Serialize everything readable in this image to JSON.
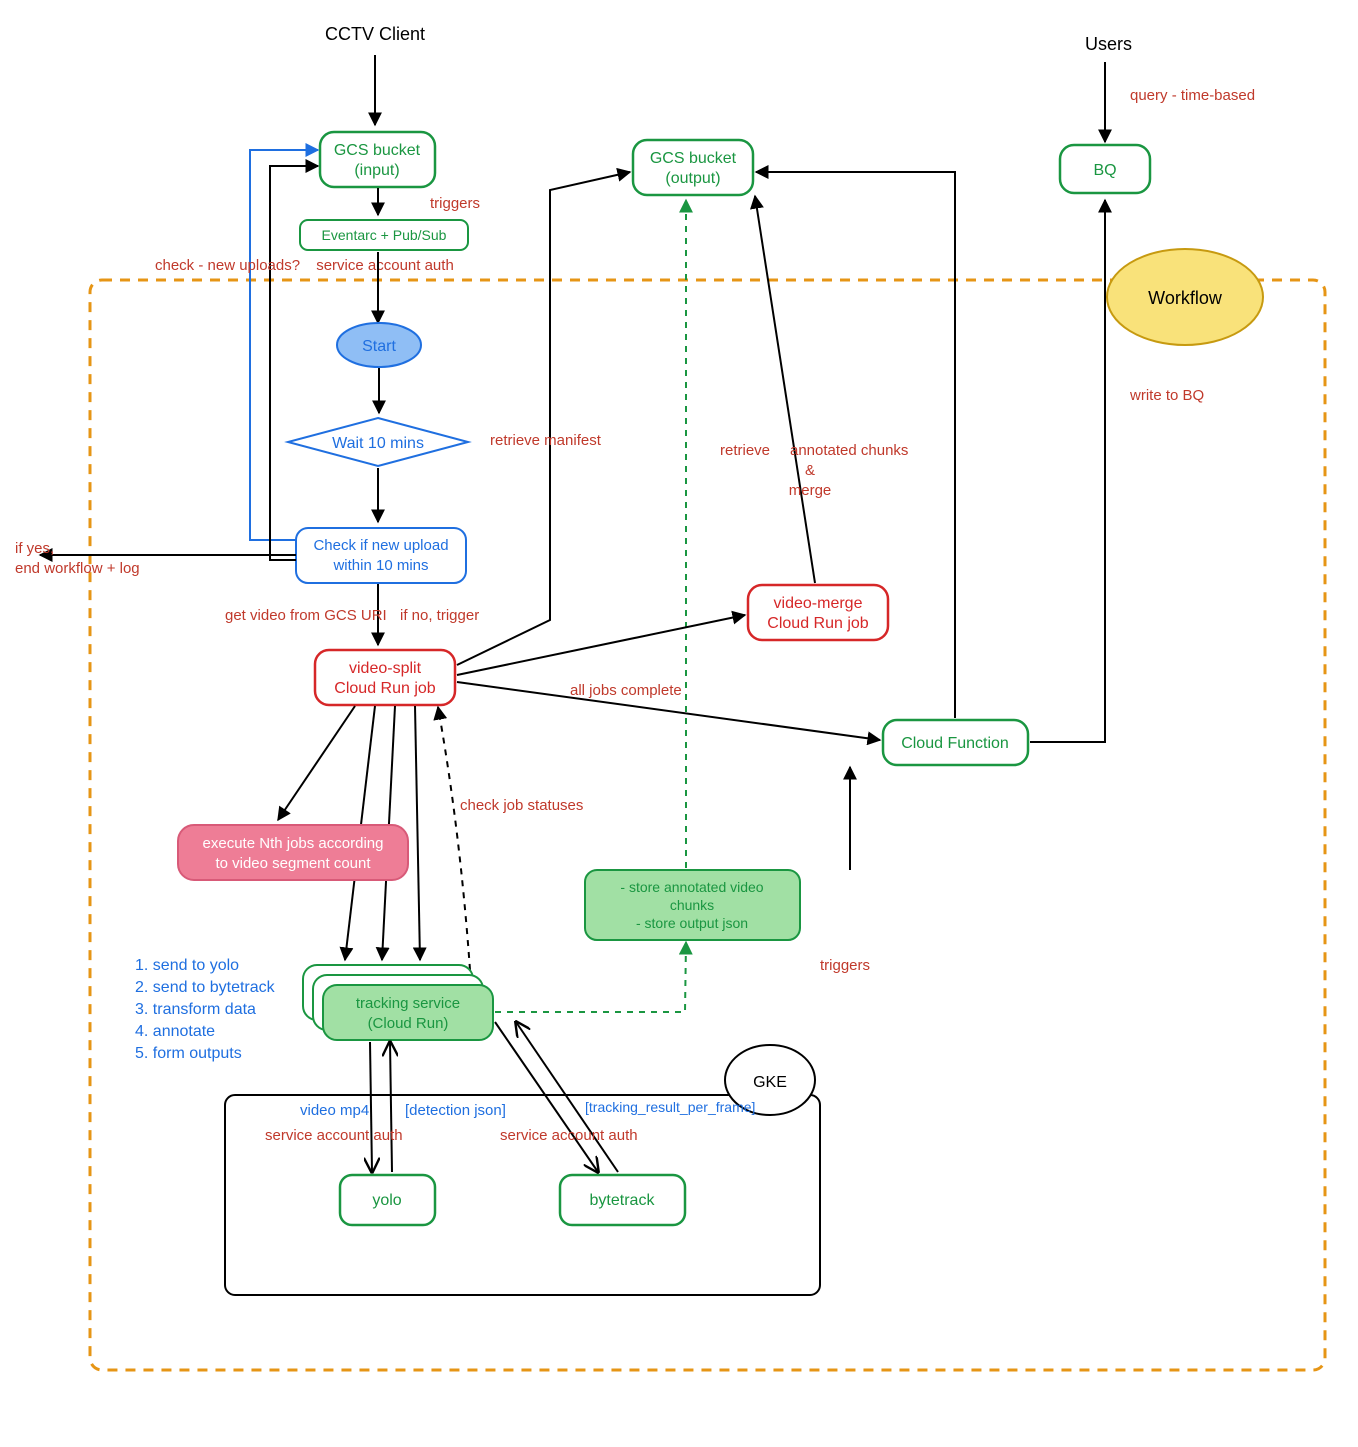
{
  "title_workflow": "Workflow",
  "external": {
    "cctv_client": "CCTV Client",
    "users": "Users",
    "gke": "GKE"
  },
  "nodes": {
    "gcs_input_l1": "GCS bucket",
    "gcs_input_l2": "(input)",
    "eventarc": "Eventarc + Pub/Sub",
    "start": "Start",
    "wait10": "Wait 10 mins",
    "check_upload_l1": "Check if new upload",
    "check_upload_l2": "within 10 mins",
    "video_split_l1": "video-split",
    "video_split_l2": "Cloud Run job",
    "execute_nth_l1": "execute Nth jobs according",
    "execute_nth_l2": "to video segment count",
    "tracking_service_l1": "tracking service",
    "tracking_service_l2": "(Cloud Run)",
    "yolo": "yolo",
    "bytetrack": "bytetrack",
    "store_chunks_l1": "- store annotated video",
    "store_chunks_l2": "chunks",
    "store_chunks_l3": "- store output json",
    "gcs_output_l1": "GCS bucket",
    "gcs_output_l2": "(output)",
    "video_merge_l1": "video-merge",
    "video_merge_l2": "Cloud Run job",
    "cloud_function": "Cloud Function",
    "bq": "BQ"
  },
  "annotations": {
    "triggers_top": "triggers",
    "service_account_auth_top": "service account auth",
    "check_new_uploads": "check - new uploads?",
    "if_yes_end_l1": "if yes,",
    "if_yes_end_l2": "end workflow + log",
    "get_video_uri": "get video from GCS URI",
    "if_no_trigger": "if no, trigger",
    "check_job_statuses": "check job statuses",
    "steps_l1": "1. send to yolo",
    "steps_l2": "2. send to bytetrack",
    "steps_l3": "3. transform data",
    "steps_l4": "4. annotate",
    "steps_l5": "5. form outputs",
    "video_mp4": "video mp4",
    "detection_json": "[detection json]",
    "service_account_auth_left": "service account auth",
    "service_account_auth_right": "service account auth",
    "tracking_result_per_frame": "[tracking_result_per_frame]",
    "triggers_right": "triggers",
    "retrieve_manifest": "retrieve manifest",
    "all_jobs_complete": "all jobs complete",
    "retrieve_annotated_l1": "retrieve",
    "retrieve_annotated_l2": "annotated chunks",
    "retrieve_annotated_amp": "&",
    "retrieve_annotated_merge": "merge",
    "query_time_based": "query - time-based",
    "write_to_bq": "write to BQ"
  },
  "colors": {
    "green": "#1a9641",
    "blue": "#1f6fe0",
    "red_text": "#c0392b",
    "red_stroke": "#d62728",
    "orange": "#e69515",
    "yellow": "#f9e27a",
    "pink_fill": "#ee7d96",
    "green_fill": "#a1e0a4",
    "blue_fill": "#8fbef5"
  }
}
